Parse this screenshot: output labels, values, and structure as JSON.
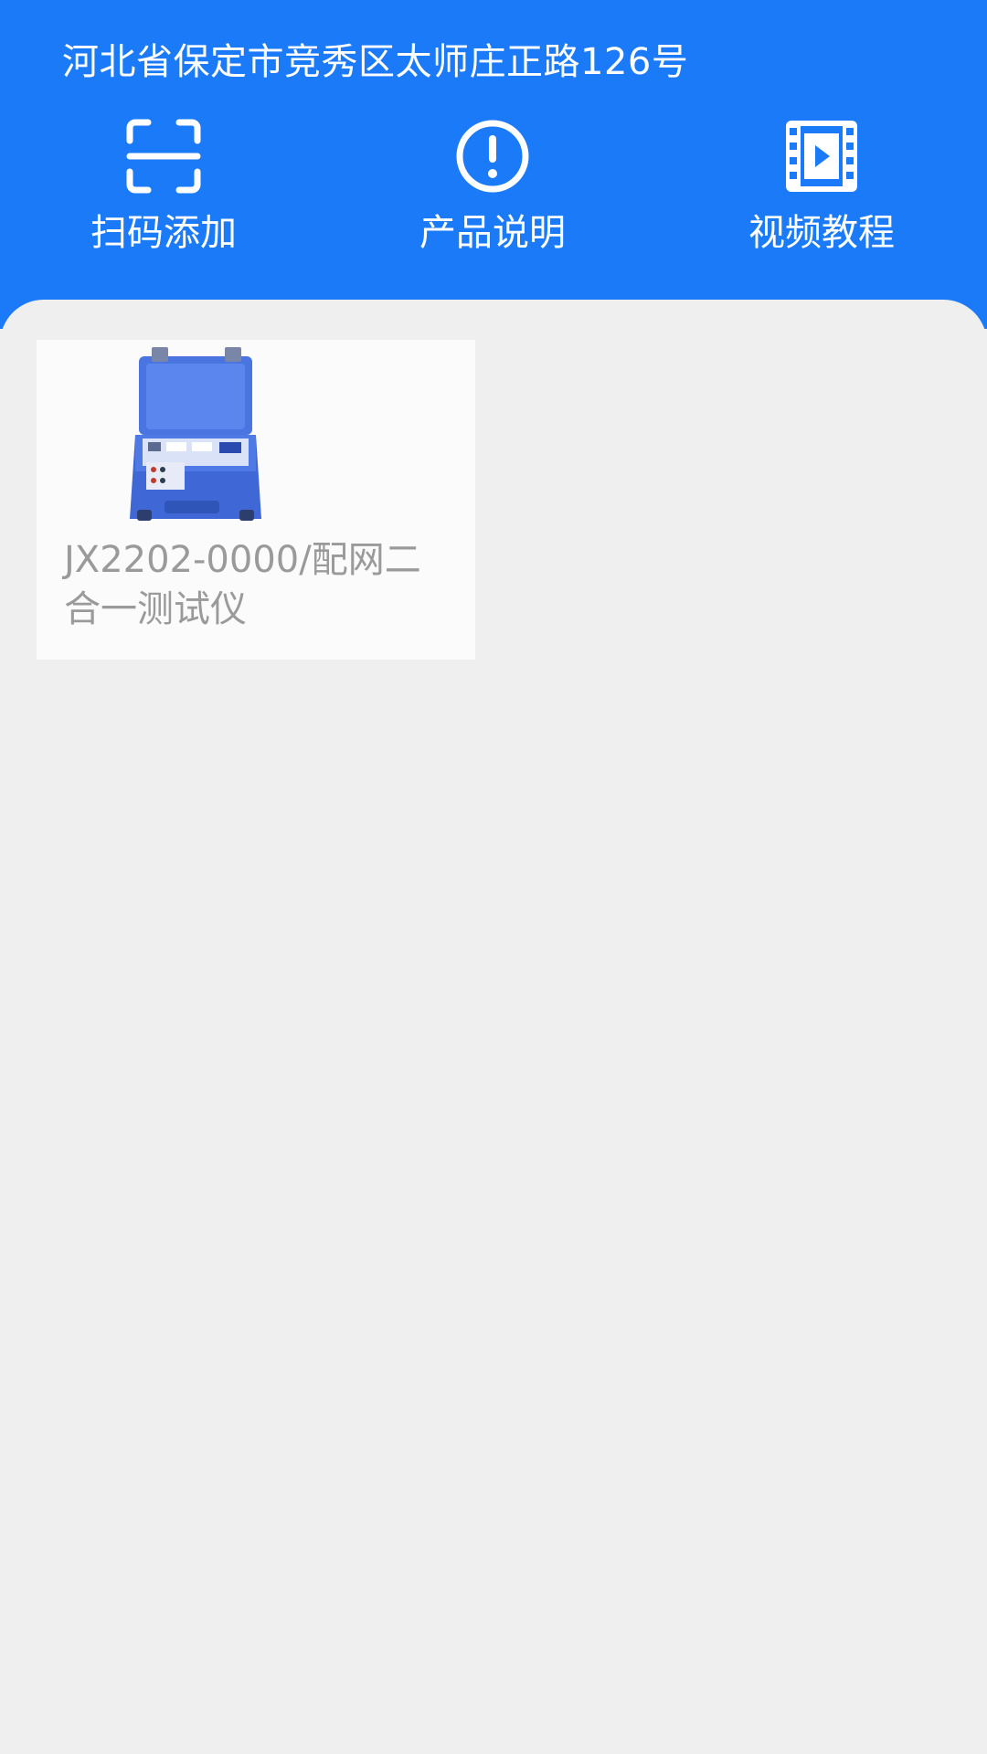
{
  "header": {
    "address": "河北省保定市竞秀区太师庄正路126号",
    "background_color": "#1a7af8"
  },
  "actions": [
    {
      "label": "扫码添加",
      "icon": "scan-icon"
    },
    {
      "label": "产品说明",
      "icon": "info-icon"
    },
    {
      "label": "视频教程",
      "icon": "video-icon"
    }
  ],
  "products": [
    {
      "name": "JX2202-0000/配网二合一测试仪",
      "image": "tester-case-image"
    }
  ],
  "colors": {
    "content_background": "#efefef",
    "card_background": "#fbfbfb",
    "product_text": "#9a9a9a"
  }
}
